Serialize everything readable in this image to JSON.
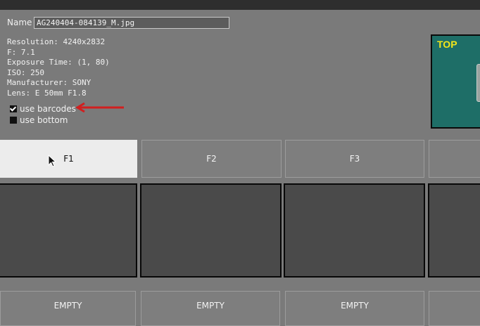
{
  "file": {
    "name_label": "Name",
    "name_value": "AG240404-084139_M.jpg"
  },
  "metadata": [
    "Resolution: 4240x2832",
    "F: 7.1",
    "Exposure Time: (1, 80)",
    "ISO: 250",
    "Manufacturer: SONY",
    "Lens: E 50mm F1.8"
  ],
  "options": {
    "use_barcodes": {
      "label": "use barcodes",
      "checked": true
    },
    "use_bottom": {
      "label": "use bottom",
      "checked": false
    }
  },
  "preview": {
    "label": "TOP"
  },
  "tabs": [
    {
      "label": "F1",
      "active": true
    },
    {
      "label": "F2",
      "active": false
    },
    {
      "label": "F3",
      "active": false
    },
    {
      "label": "",
      "active": false
    }
  ],
  "slots": [
    {
      "label": "EMPTY"
    },
    {
      "label": "EMPTY"
    },
    {
      "label": "EMPTY"
    },
    {
      "label": ""
    }
  ],
  "colors": {
    "arrow": "#d11f1f",
    "preview_bg": "#1e6e67",
    "preview_label": "#f3e61b",
    "active_tab": "#ececec"
  }
}
